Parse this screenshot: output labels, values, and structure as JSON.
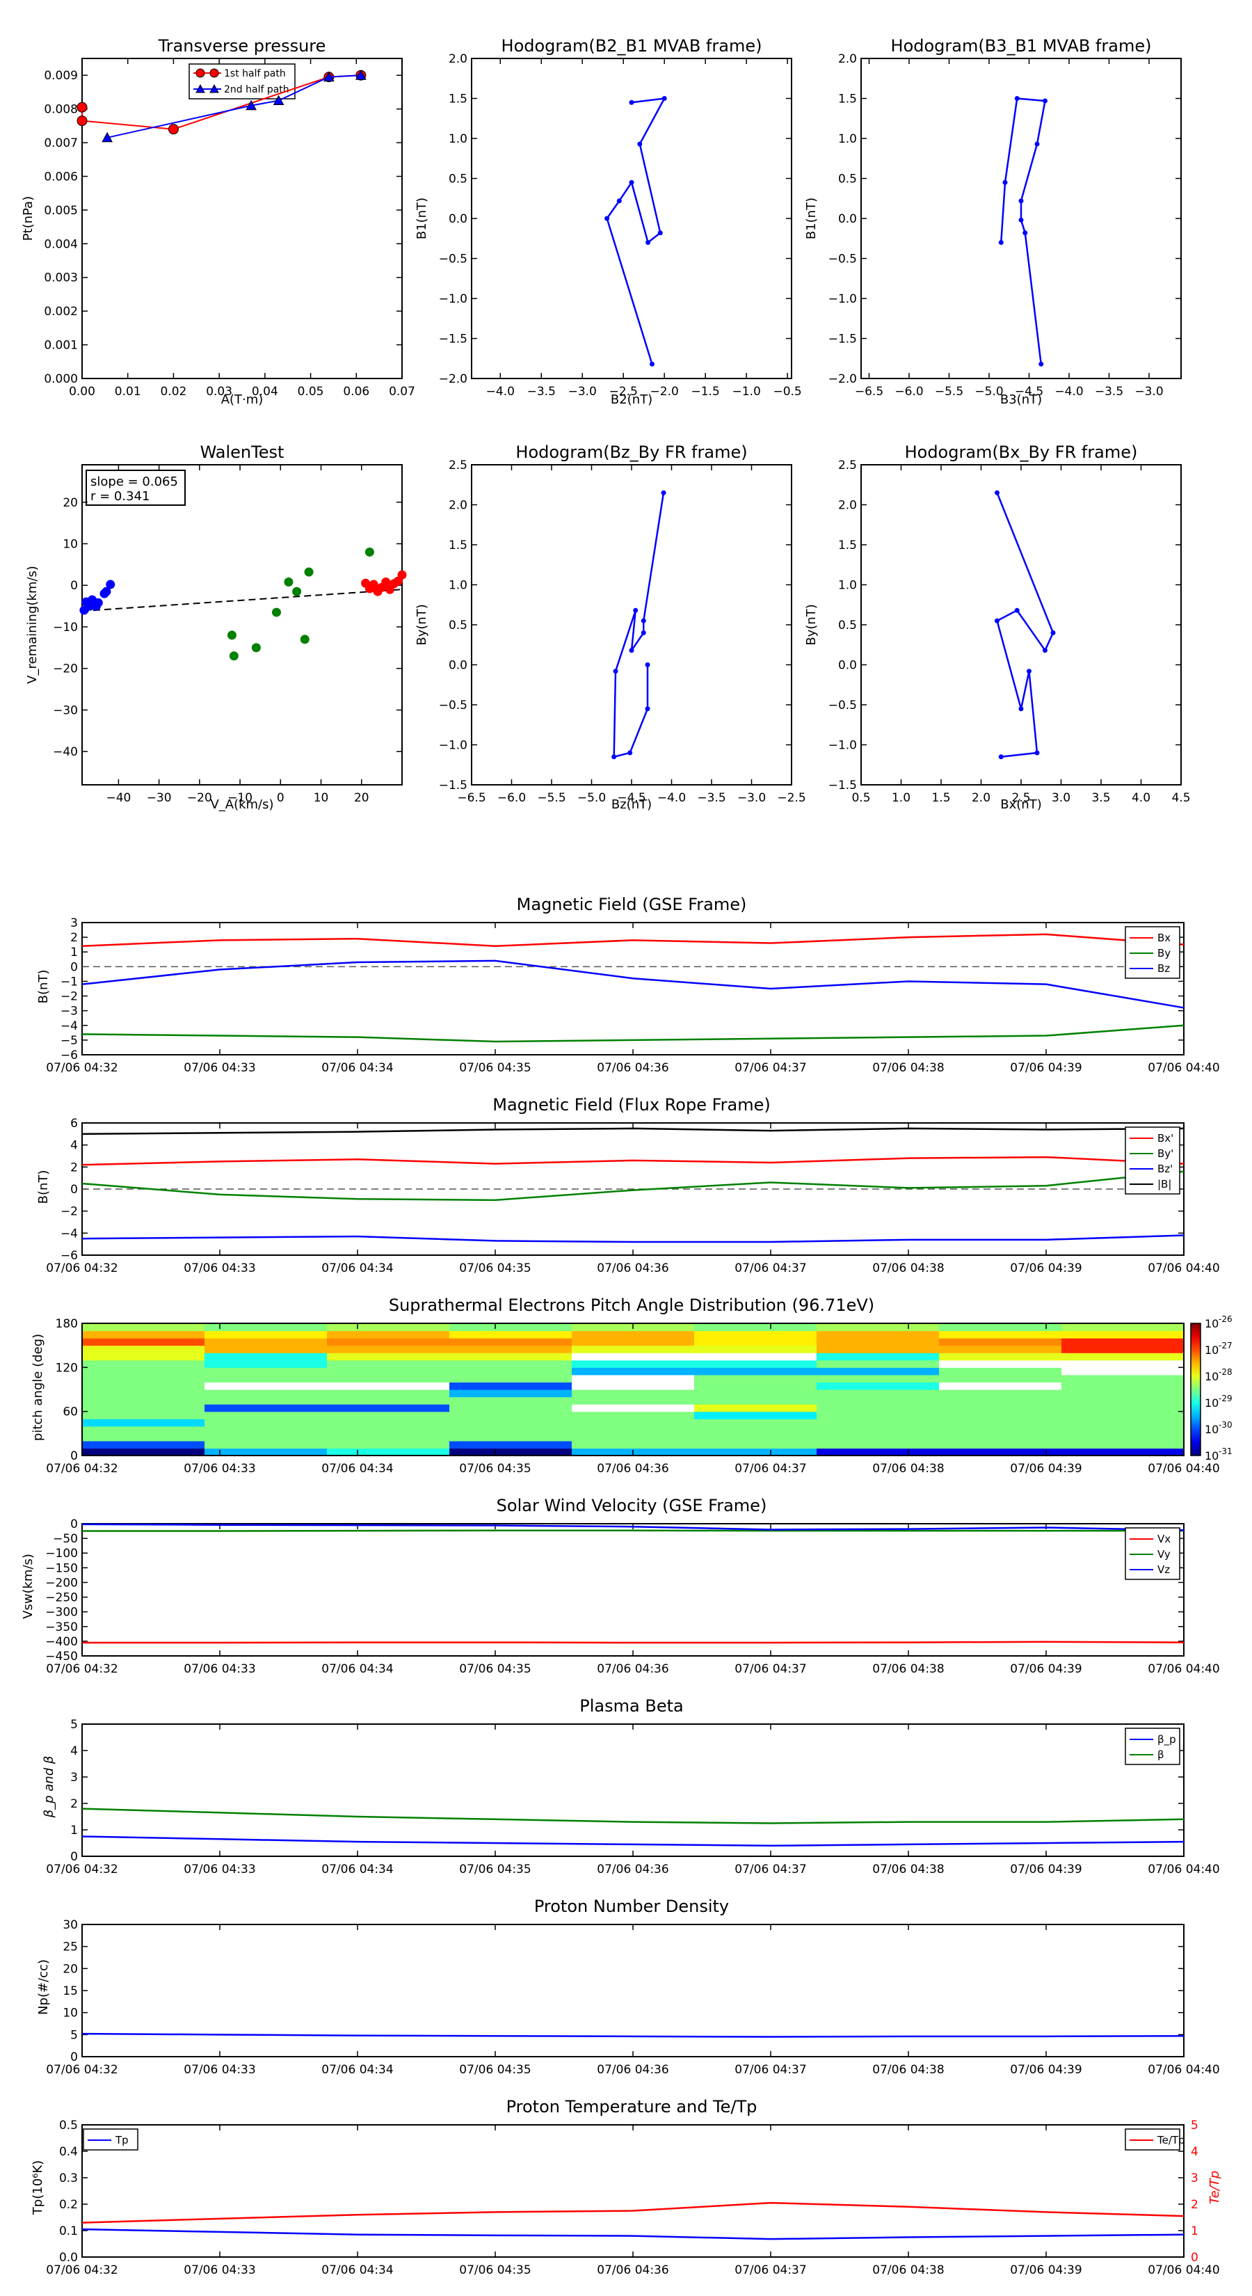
{
  "colors": {
    "red": "#ff0000",
    "green": "#008000",
    "blue": "#0000ff",
    "black": "#000000"
  },
  "time_ticks": [
    "07/06 04:32",
    "07/06 04:33",
    "07/06 04:34",
    "07/06 04:35",
    "07/06 04:36",
    "07/06 04:37",
    "07/06 04:38",
    "07/06 04:39",
    "07/06 04:40"
  ],
  "transverse_pressure": {
    "title": "Transverse pressure",
    "xlabel": "A(T·m)",
    "ylabel": "Pt(nPa)",
    "xlim": [
      0,
      0.07
    ],
    "ylim": [
      0,
      0.0095
    ],
    "xticks": [
      "0.00",
      "0.01",
      "0.02",
      "0.03",
      "0.04",
      "0.05",
      "0.06",
      "0.07"
    ],
    "yticks": [
      "0.000",
      "0.001",
      "0.002",
      "0.003",
      "0.004",
      "0.005",
      "0.006",
      "0.007",
      "0.008",
      "0.009"
    ],
    "legend": [
      "1st half path",
      "2nd half path"
    ]
  },
  "hodo1": {
    "title": "Hodogram(B2_B1 MVAB frame)",
    "xlabel": "B2(nT)",
    "ylabel": "B1(nT)",
    "xlim": [
      -4.35,
      -0.45
    ],
    "ylim": [
      -2.0,
      2.0
    ],
    "xticks": [
      "−4.0",
      "−3.5",
      "−3.0",
      "−2.5",
      "−2.0",
      "−1.5",
      "−1.0",
      "−0.5"
    ],
    "yticks": [
      "−2.0",
      "−1.5",
      "−1.0",
      "−0.5",
      "0.0",
      "0.5",
      "1.0",
      "1.5",
      "2.0"
    ]
  },
  "hodo2": {
    "title": "Hodogram(B3_B1 MVAB frame)",
    "xlabel": "B3(nT)",
    "ylabel": "B1(nT)",
    "xlim": [
      -6.6,
      -2.6
    ],
    "ylim": [
      -2.0,
      2.0
    ],
    "xticks": [
      "−6.5",
      "−6.0",
      "−5.5",
      "−5.0",
      "−4.5",
      "−4.0",
      "−3.5",
      "−3.0"
    ],
    "yticks": [
      "−2.0",
      "−1.5",
      "−1.0",
      "−0.5",
      "0.0",
      "0.5",
      "1.0",
      "1.5",
      "2.0"
    ]
  },
  "walen": {
    "title": "WalenTest",
    "xlabel": "V_A(km/s)",
    "ylabel": "V_remaining(km/s)",
    "xlim": [
      -49,
      30
    ],
    "ylim": [
      -48,
      29
    ],
    "xticks": [
      "−40",
      "−30",
      "−20",
      "−10",
      "0",
      "10",
      "20"
    ],
    "yticks": [
      "−40",
      "−30",
      "−20",
      "−10",
      "0",
      "10",
      "20"
    ],
    "slope_text": "slope = 0.065",
    "r_text": "r = 0.341"
  },
  "hodo3": {
    "title": "Hodogram(Bz_By FR frame)",
    "xlabel": "Bz(nT)",
    "ylabel": "By(nT)",
    "xlim": [
      -6.5,
      -2.5
    ],
    "ylim": [
      -1.5,
      2.5
    ],
    "xticks": [
      "−6.5",
      "−6.0",
      "−5.5",
      "−5.0",
      "−4.5",
      "−4.0",
      "−3.5",
      "−3.0",
      "−2.5"
    ],
    "yticks": [
      "−1.5",
      "−1.0",
      "−0.5",
      "0.0",
      "0.5",
      "1.0",
      "1.5",
      "2.0",
      "2.5"
    ]
  },
  "hodo4": {
    "title": "Hodogram(Bx_By FR frame)",
    "xlabel": "Bx(nT)",
    "ylabel": "By(nT)",
    "xlim": [
      0.5,
      4.5
    ],
    "ylim": [
      -1.5,
      2.5
    ],
    "xticks": [
      "0.5",
      "1.0",
      "1.5",
      "2.0",
      "2.5",
      "3.0",
      "3.5",
      "4.0",
      "4.5"
    ],
    "yticks": [
      "−1.5",
      "−1.0",
      "−0.5",
      "0.0",
      "0.5",
      "1.0",
      "1.5",
      "2.0",
      "2.5"
    ]
  },
  "mag_gse": {
    "title": "Magnetic Field (GSE Frame)",
    "ylabel": "B(nT)",
    "ylim": [
      -6,
      3
    ],
    "yticks": [
      "−6",
      "−5",
      "−4",
      "−3",
      "−2",
      "−1",
      "0",
      "1",
      "2",
      "3"
    ],
    "legend": [
      "Bx",
      "By",
      "Bz"
    ]
  },
  "mag_fr": {
    "title": "Magnetic Field (Flux Rope Frame)",
    "ylabel": "B(nT)",
    "ylim": [
      -6,
      6
    ],
    "yticks": [
      "−6",
      "−4",
      "−2",
      "0",
      "2",
      "4",
      "6"
    ],
    "legend": [
      "Bx'",
      "By'",
      "Bz'",
      "|B|"
    ]
  },
  "pad": {
    "title": "Suprathermal Electrons Pitch Angle Distribution (96.71eV)",
    "ylabel": "pitch angle (deg)",
    "ylim": [
      0,
      180
    ],
    "yticks": [
      "0",
      "60",
      "120",
      "180"
    ],
    "cbar_ticks": [
      "10",
      "10",
      "10",
      "10",
      "10",
      "10"
    ],
    "cbar_exps": [
      "-31",
      "-30",
      "-29",
      "-28",
      "-27",
      "-26"
    ]
  },
  "sw_vel": {
    "title": "Solar Wind Velocity (GSE Frame)",
    "ylabel": "Vsw(km/s)",
    "ylim": [
      -450,
      0
    ],
    "yticks": [
      "−450",
      "−400",
      "−350",
      "−300",
      "−250",
      "−200",
      "−150",
      "−100",
      "−50",
      "0"
    ],
    "legend": [
      "Vx",
      "Vy",
      "Vz"
    ]
  },
  "beta": {
    "title": "Plasma Beta",
    "ylabel": "β_p and β",
    "ylim": [
      0,
      5
    ],
    "yticks": [
      "0",
      "1",
      "2",
      "3",
      "4",
      "5"
    ],
    "legend": [
      "β_p",
      "β"
    ]
  },
  "density": {
    "title": "Proton Number Density",
    "ylabel": "Np(#/cc)",
    "ylim": [
      0,
      30
    ],
    "yticks": [
      "0",
      "5",
      "10",
      "15",
      "20",
      "25",
      "30"
    ]
  },
  "temp": {
    "title": "Proton Temperature and Te/Tp",
    "ylabel": "Tp(10⁶K)",
    "ylim": [
      0,
      0.5
    ],
    "yticks": [
      "0.0",
      "0.1",
      "0.2",
      "0.3",
      "0.4",
      "0.5"
    ],
    "y2label": "Te/Tp",
    "y2ticks": [
      "0",
      "1",
      "2",
      "3",
      "4",
      "5"
    ],
    "legend": [
      "Tp"
    ],
    "legend2": [
      "Te/Tp"
    ]
  },
  "chart_data": [
    {
      "type": "line",
      "id": "transverse_pressure",
      "title": "Transverse pressure",
      "series": [
        {
          "name": "1st half path",
          "marker": "circle",
          "x": [
            0.0,
            0.0,
            0.02,
            0.054,
            0.061
          ],
          "y": [
            0.00805,
            0.00765,
            0.0074,
            0.00895,
            0.009
          ]
        },
        {
          "name": "2nd half path",
          "marker": "triangle",
          "x": [
            0.061,
            0.054,
            0.043,
            0.037,
            0.0055
          ],
          "y": [
            0.009,
            0.00895,
            0.00825,
            0.0081,
            0.00715
          ]
        }
      ]
    },
    {
      "type": "line",
      "id": "hodo1",
      "title": "Hodogram(B2_B1 MVAB frame)",
      "x": [
        -2.15,
        -2.7,
        -2.55,
        -2.4,
        -2.2,
        -2.05,
        -2.3,
        -2.0,
        -2.4
      ],
      "y": [
        -1.82,
        0.0,
        0.22,
        0.45,
        -0.3,
        -0.18,
        0.93,
        1.5,
        1.45
      ]
    },
    {
      "type": "line",
      "id": "hodo2",
      "title": "Hodogram(B3_B1 MVAB frame)",
      "x": [
        -4.35,
        -4.55,
        -4.6,
        -4.6,
        -4.4,
        -4.3,
        -4.65,
        -4.8,
        -4.85
      ],
      "y": [
        -1.82,
        -0.18,
        -0.02,
        0.22,
        0.93,
        1.47,
        1.5,
        0.45,
        -0.3
      ]
    },
    {
      "type": "scatter",
      "id": "walen",
      "title": "WalenTest",
      "series": [
        {
          "color": "red",
          "x": [
            21,
            22,
            23,
            24,
            25,
            26,
            27,
            28,
            29,
            30
          ],
          "y": [
            0.5,
            -0.8,
            0.2,
            -1.5,
            -0.5,
            0.8,
            -1.0,
            0.4,
            1.0,
            2.5
          ]
        },
        {
          "color": "green",
          "x": [
            -12,
            -11.5,
            -6,
            -1,
            2,
            4,
            6,
            7,
            22
          ],
          "y": [
            -12,
            -17,
            -15,
            -6.5,
            0.8,
            -1.5,
            -13,
            3.2,
            8
          ]
        },
        {
          "color": "blue",
          "x": [
            -48,
            -47,
            -46.5,
            -46,
            -45.5,
            -45,
            -43.5,
            -43,
            -42,
            -48.5
          ],
          "y": [
            -4,
            -5,
            -3.5,
            -4.5,
            -5,
            -4.2,
            -2,
            -1.5,
            0.2,
            -6
          ]
        }
      ],
      "fit": {
        "slope": 0.065,
        "x": [
          -49,
          30
        ],
        "y": [
          -6.2,
          -1.0
        ]
      }
    },
    {
      "type": "line",
      "id": "hodo3",
      "title": "Hodogram(Bz_By FR frame)",
      "x": [
        -4.1,
        -4.35,
        -4.35,
        -4.5,
        -4.45,
        -4.7,
        -4.72,
        -4.52,
        -4.3,
        -4.3
      ],
      "y": [
        2.15,
        0.55,
        0.4,
        0.18,
        0.68,
        -0.08,
        -1.15,
        -1.1,
        -0.55,
        0.0
      ]
    },
    {
      "type": "line",
      "id": "hodo4",
      "title": "Hodogram(Bx_By FR frame)",
      "x": [
        2.2,
        2.9,
        2.8,
        2.45,
        2.2,
        2.5,
        2.6,
        2.7,
        2.25
      ],
      "y": [
        2.15,
        0.4,
        0.18,
        0.68,
        0.55,
        -0.55,
        -0.08,
        -1.1,
        -1.15
      ]
    },
    {
      "type": "line",
      "id": "mag_gse",
      "title": "Magnetic Field (GSE Frame)",
      "x": [
        "07/06 04:32",
        "07/06 04:33",
        "07/06 04:34",
        "07/06 04:35",
        "07/06 04:36",
        "07/06 04:37",
        "07/06 04:38",
        "07/06 04:39",
        "07/06 04:40"
      ],
      "series": [
        {
          "name": "Bx",
          "color": "red",
          "values": [
            1.4,
            1.8,
            1.9,
            1.4,
            1.8,
            1.6,
            2.0,
            2.2,
            1.5
          ]
        },
        {
          "name": "By",
          "color": "green",
          "values": [
            -4.6,
            -4.7,
            -4.8,
            -5.1,
            -5.0,
            -4.9,
            -4.8,
            -4.7,
            -4.0
          ]
        },
        {
          "name": "Bz",
          "color": "blue",
          "values": [
            -1.2,
            -0.2,
            0.3,
            0.4,
            -0.8,
            -1.5,
            -1.0,
            -1.2,
            -2.8
          ]
        }
      ],
      "zero_line": true
    },
    {
      "type": "line",
      "id": "mag_fr",
      "title": "Magnetic Field (Flux Rope Frame)",
      "x": [
        "07/06 04:32",
        "07/06 04:33",
        "07/06 04:34",
        "07/06 04:35",
        "07/06 04:36",
        "07/06 04:37",
        "07/06 04:38",
        "07/06 04:39",
        "07/06 04:40"
      ],
      "series": [
        {
          "name": "Bx'",
          "color": "red",
          "values": [
            2.2,
            2.5,
            2.7,
            2.3,
            2.6,
            2.4,
            2.8,
            2.9,
            2.3
          ]
        },
        {
          "name": "By'",
          "color": "green",
          "values": [
            0.5,
            -0.5,
            -0.9,
            -1.0,
            -0.1,
            0.6,
            0.1,
            0.3,
            1.6
          ]
        },
        {
          "name": "Bz'",
          "color": "blue",
          "values": [
            -4.5,
            -4.4,
            -4.3,
            -4.7,
            -4.8,
            -4.8,
            -4.6,
            -4.6,
            -4.2
          ]
        },
        {
          "name": "|B|",
          "color": "black",
          "values": [
            5.0,
            5.1,
            5.2,
            5.4,
            5.5,
            5.3,
            5.5,
            5.4,
            5.5
          ]
        }
      ],
      "zero_line": true
    },
    {
      "type": "heatmap",
      "id": "pad",
      "title": "Suprathermal Electrons Pitch Angle Distribution (96.71eV)",
      "y_bins": [
        0,
        10,
        20,
        30,
        40,
        50,
        60,
        70,
        80,
        90,
        100,
        110,
        120,
        130,
        140,
        150,
        160,
        170,
        180
      ],
      "log10_values": [
        [
          -31.0,
          -29.5,
          -29.0,
          -31.0,
          -29.5,
          -29.5,
          -30.5,
          -30.5,
          -30.5
        ],
        [
          -30.0,
          -28.5,
          -28.5,
          -30.0,
          -28.5,
          -28.5,
          -28.5,
          -28.5,
          -28.5
        ],
        [
          -28.5,
          -28.5,
          -28.5,
          -28.5,
          -28.5,
          -28.5,
          -28.5,
          -28.5,
          -28.5
        ],
        [
          -28.5,
          -28.5,
          -28.5,
          -28.5,
          -28.5,
          -28.5,
          -28.5,
          -28.5,
          -28.5
        ],
        [
          -29.3,
          -28.5,
          -28.5,
          -28.5,
          -28.5,
          -28.5,
          -28.5,
          -28.5,
          -28.5
        ],
        [
          -28.5,
          -28.5,
          -28.5,
          -28.5,
          -28.5,
          -29.2,
          -28.5,
          -28.5,
          -28.5
        ],
        [
          -28.5,
          -30.0,
          -30.0,
          -28.5,
          -26.0,
          -28.0,
          -28.5,
          -28.5,
          -28.5
        ],
        [
          -28.5,
          -28.5,
          -28.5,
          -28.5,
          -28.5,
          -28.5,
          -28.5,
          -28.5,
          -28.5
        ],
        [
          -28.5,
          -28.5,
          -28.5,
          -29.5,
          -28.5,
          -28.5,
          -28.5,
          -28.5,
          -28.5
        ],
        [
          -28.5,
          -26.0,
          -26.0,
          -30.0,
          -26.0,
          -28.5,
          -29.0,
          -26.0,
          -28.5
        ],
        [
          -28.5,
          -28.5,
          -28.5,
          -28.5,
          -26.0,
          -28.5,
          -28.5,
          -28.5,
          -28.5
        ],
        [
          -28.5,
          -28.5,
          -28.5,
          -28.5,
          -29.5,
          -29.5,
          -29.5,
          -28.5,
          -26.0
        ],
        [
          -28.5,
          -29.0,
          -28.5,
          -28.5,
          -29.0,
          -29.0,
          -28.5,
          -26.0,
          -26.0
        ],
        [
          -28.0,
          -29.0,
          -28.0,
          -28.0,
          -26.0,
          -26.0,
          -29.0,
          -28.0,
          -28.0
        ],
        [
          -28.0,
          -27.5,
          -27.5,
          -27.5,
          -28.0,
          -28.0,
          -27.5,
          -27.5,
          -26.8
        ],
        [
          -27.0,
          -27.5,
          -27.3,
          -27.3,
          -27.5,
          -27.8,
          -27.5,
          -27.3,
          -26.8
        ],
        [
          -27.5,
          -27.8,
          -27.5,
          -27.8,
          -27.5,
          -27.8,
          -27.5,
          -27.8,
          -27.8
        ],
        [
          -28.3,
          -28.5,
          -28.3,
          -28.5,
          -28.3,
          -28.5,
          -28.3,
          -28.5,
          -28.3
        ]
      ]
    },
    {
      "type": "line",
      "id": "sw_vel",
      "title": "Solar Wind Velocity (GSE Frame)",
      "x": [
        "07/06 04:32",
        "07/06 04:33",
        "07/06 04:34",
        "07/06 04:35",
        "07/06 04:36",
        "07/06 04:37",
        "07/06 04:38",
        "07/06 04:39",
        "07/06 04:40"
      ],
      "series": [
        {
          "name": "Vx",
          "color": "red",
          "values": [
            -405,
            -405,
            -404,
            -404,
            -405,
            -405,
            -404,
            -402,
            -404
          ]
        },
        {
          "name": "Vy",
          "color": "green",
          "values": [
            -25,
            -25,
            -24,
            -23,
            -23,
            -24,
            -24,
            -24,
            -24
          ]
        },
        {
          "name": "Vz",
          "color": "blue",
          "values": [
            -2,
            -4,
            -5,
            -6,
            -10,
            -20,
            -18,
            -13,
            -22
          ]
        }
      ]
    },
    {
      "type": "line",
      "id": "beta",
      "title": "Plasma Beta",
      "x": [
        "07/06 04:32",
        "07/06 04:33",
        "07/06 04:34",
        "07/06 04:35",
        "07/06 04:36",
        "07/06 04:37",
        "07/06 04:38",
        "07/06 04:39",
        "07/06 04:40"
      ],
      "series": [
        {
          "name": "β_p",
          "color": "blue",
          "values": [
            0.75,
            0.65,
            0.55,
            0.5,
            0.45,
            0.4,
            0.45,
            0.5,
            0.55
          ]
        },
        {
          "name": "β",
          "color": "green",
          "values": [
            1.8,
            1.65,
            1.5,
            1.4,
            1.3,
            1.25,
            1.3,
            1.3,
            1.4
          ]
        }
      ]
    },
    {
      "type": "line",
      "id": "density",
      "title": "Proton Number Density",
      "x": [
        "07/06 04:32",
        "07/06 04:33",
        "07/06 04:34",
        "07/06 04:35",
        "07/06 04:36",
        "07/06 04:37",
        "07/06 04:38",
        "07/06 04:39",
        "07/06 04:40"
      ],
      "series": [
        {
          "color": "blue",
          "values": [
            5.2,
            5.0,
            4.8,
            4.7,
            4.6,
            4.5,
            4.6,
            4.6,
            4.7
          ]
        }
      ]
    },
    {
      "type": "line",
      "id": "temp",
      "title": "Proton Temperature and Te/Tp",
      "x": [
        "07/06 04:32",
        "07/06 04:33",
        "07/06 04:34",
        "07/06 04:35",
        "07/06 04:36",
        "07/06 04:37",
        "07/06 04:38",
        "07/06 04:39",
        "07/06 04:40"
      ],
      "series": [
        {
          "name": "Tp",
          "color": "blue",
          "axis": "left",
          "values": [
            0.105,
            0.095,
            0.085,
            0.082,
            0.08,
            0.068,
            0.075,
            0.08,
            0.085
          ]
        },
        {
          "name": "Te/Tp",
          "color": "red",
          "axis": "right",
          "values": [
            1.3,
            1.45,
            1.6,
            1.7,
            1.75,
            2.05,
            1.9,
            1.7,
            1.55
          ]
        }
      ]
    }
  ]
}
